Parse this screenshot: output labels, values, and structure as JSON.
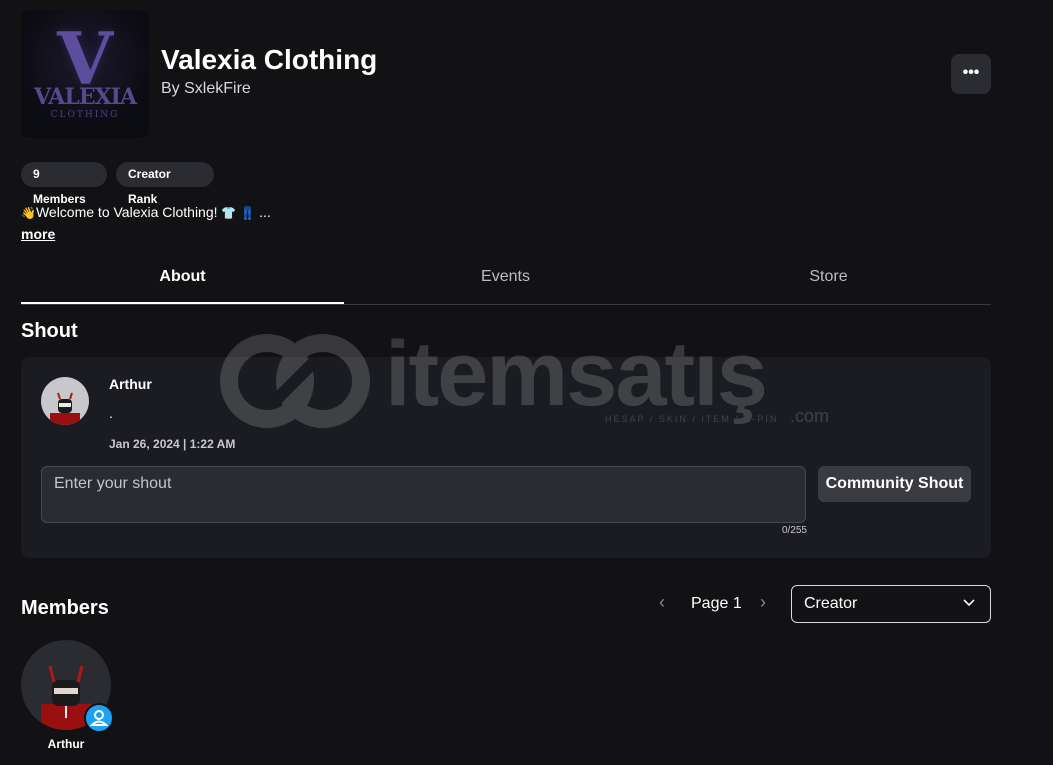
{
  "group": {
    "logo_text": "VALEXIA",
    "logo_sub": "CLOTHING",
    "name": "Valexia Clothing",
    "owner": "By SxlekFire",
    "more_menu": "•••",
    "badges": [
      "9 Members",
      "Creator Rank"
    ],
    "description_text": "Welcome to Valexia Clothing!",
    "description_more": "more"
  },
  "tabs": [
    "About",
    "Events",
    "Store"
  ],
  "active_tab": "About",
  "shout": {
    "heading": "Shout",
    "poster": "Arthur",
    "body": ".",
    "date": "Jan 26, 2024 | 1:22 AM",
    "input_placeholder": "Enter your shout",
    "char_count": "0/255",
    "button_label": "Community Shout"
  },
  "members": {
    "heading": "Members",
    "page_label": "Page 1",
    "role_filter": "Creator",
    "list": [
      {
        "name": "Arthur"
      }
    ]
  },
  "watermark": {
    "brand": "itemsatış",
    "tagline": "HESAP / SKIN / ITEM / E-PIN",
    "domain": ".com"
  },
  "colors": {
    "background": "#121215",
    "card": "#1b1c21",
    "pill": "#2b2c31",
    "accent_badge": "#1da1f2"
  }
}
